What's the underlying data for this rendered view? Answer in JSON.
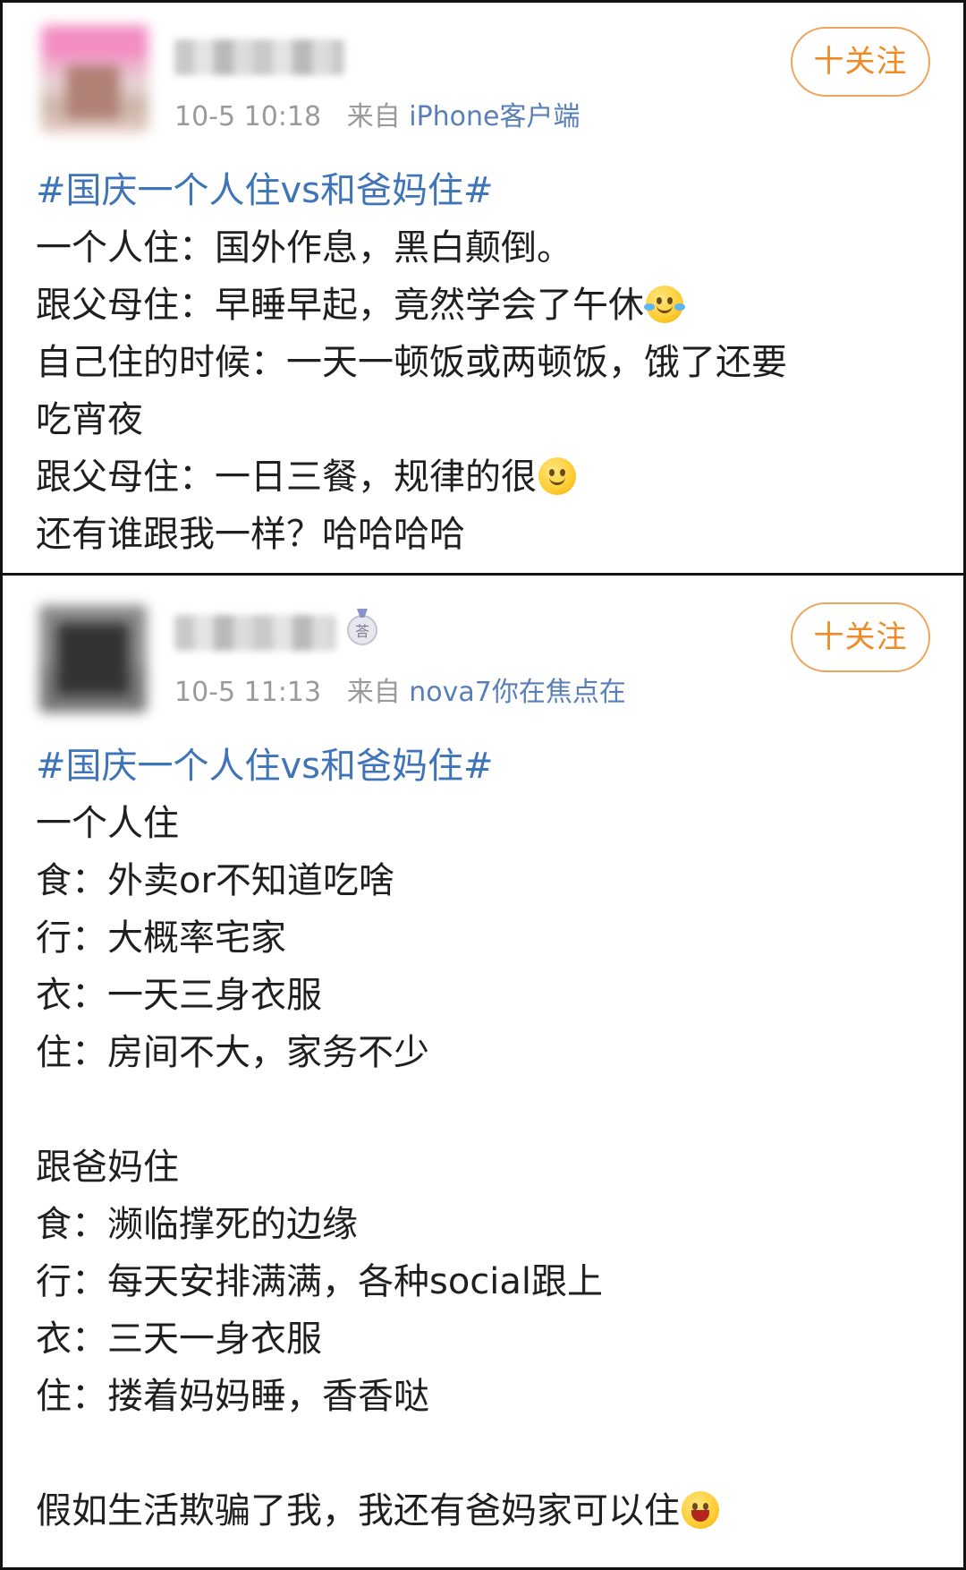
{
  "posts": [
    {
      "time": "10-5 10:18",
      "source_prefix": "来自",
      "source_device": "iPhone客户端",
      "follow_label": "十关注",
      "lines": [
        {
          "text": "#国庆一个人住vs和爸妈住#",
          "topic": true
        },
        {
          "text": "一个人住：国外作息，黑白颠倒。"
        },
        {
          "text": "跟父母住：早睡早起，竟然学会了午休",
          "emoji": "laugh-tears-emoji"
        },
        {
          "text": "自己住的时候：一天一顿饭或两顿饭，饿了还要"
        },
        {
          "text": "吃宵夜"
        },
        {
          "text": "跟父母住：一日三餐，规律的很",
          "emoji": "smile-emoji"
        },
        {
          "text": "还有谁跟我一样？哈哈哈哈"
        }
      ]
    },
    {
      "time": "10-5 11:13",
      "source_prefix": "来自",
      "source_device": "nova7你在焦点在",
      "follow_label": "十关注",
      "lines": [
        {
          "text": "#国庆一个人住vs和爸妈住#",
          "topic": true
        },
        {
          "text": "一个人住"
        },
        {
          "text": "食：外卖or不知道吃啥"
        },
        {
          "text": "行：大概率宅家"
        },
        {
          "text": "衣：一天三身衣服"
        },
        {
          "text": "住：房间不大，家务不少"
        },
        {
          "text": ""
        },
        {
          "text": "跟爸妈住"
        },
        {
          "text": "食：濒临撑死的边缘"
        },
        {
          "text": "行：每天安排满满，各种social跟上"
        },
        {
          "text": "衣：三天一身衣服"
        },
        {
          "text": "住：搂着妈妈睡，香香哒"
        },
        {
          "text": ""
        },
        {
          "text": "假如生活欺骗了我，我还有爸妈家可以住",
          "emoji": "grin-emoji"
        }
      ]
    }
  ],
  "colors": {
    "topic": "#3f74b8",
    "device": "#5a7fb8",
    "meta": "#9a9a9a",
    "follow": "#f08a24",
    "text": "#1f1f1f"
  }
}
